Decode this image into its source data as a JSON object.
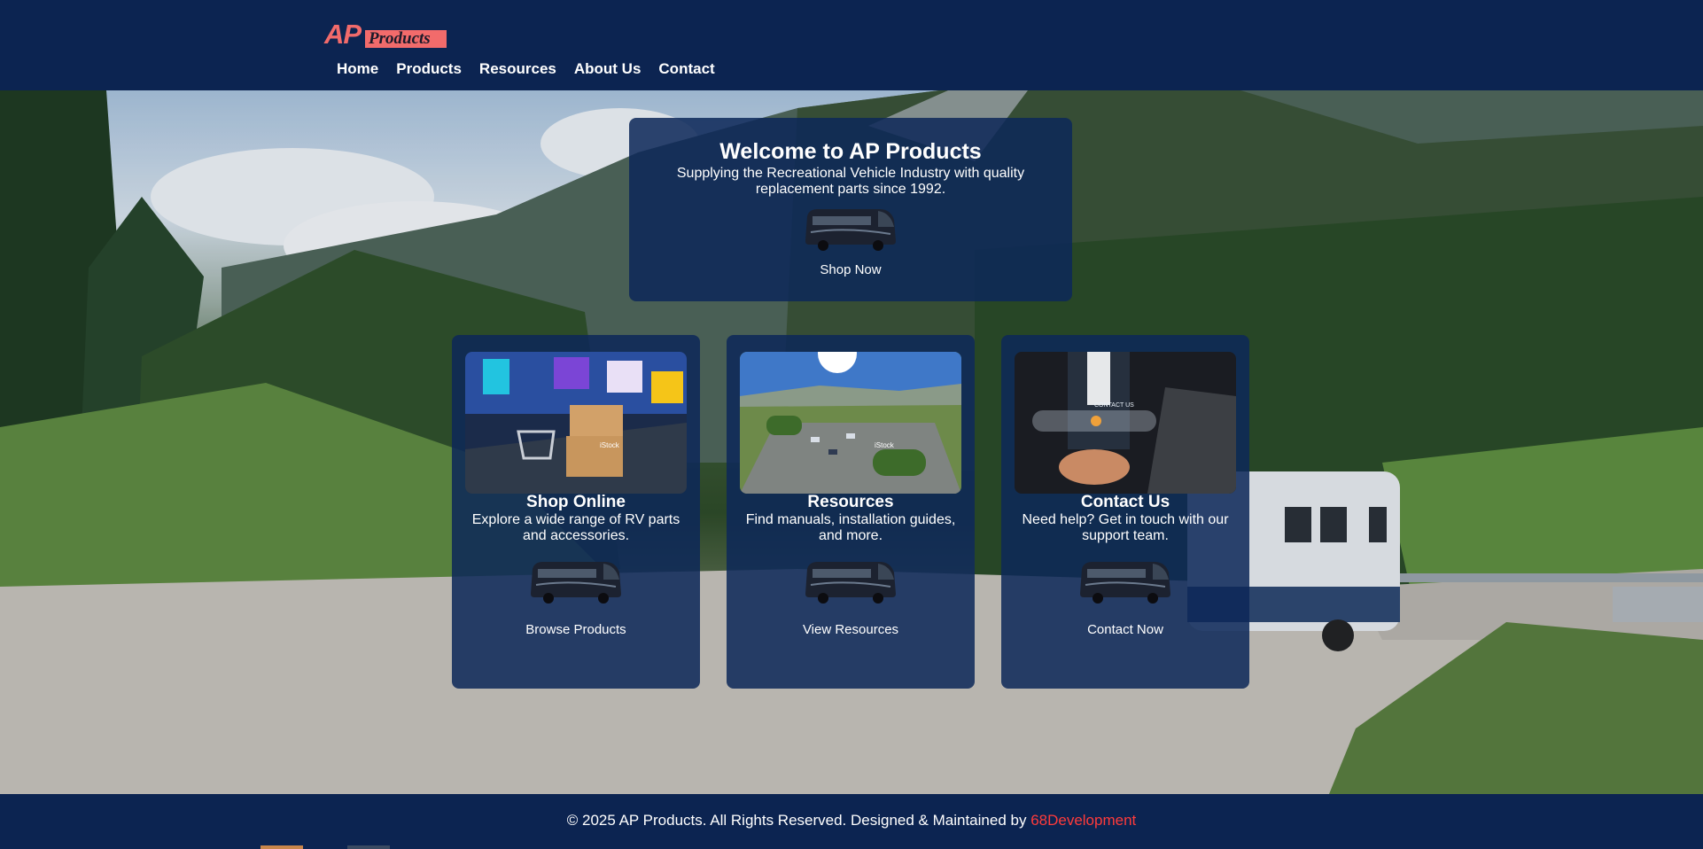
{
  "header": {
    "logo_ap": "AP",
    "logo_products": "Products",
    "nav": [
      "Home",
      "Products",
      "Resources",
      "About Us",
      "Contact"
    ]
  },
  "welcome": {
    "title": "Welcome to AP Products",
    "subtitle": "Supplying the Recreational Vehicle Industry with quality replacement parts since 1992.",
    "cta": "Shop Now"
  },
  "features": [
    {
      "title": "Shop Online",
      "text": "Explore a wide range of RV parts and accessories.",
      "cta": "Browse Products"
    },
    {
      "title": "Resources",
      "text": "Find manuals, installation guides, and more.",
      "cta": "View Resources"
    },
    {
      "title": "Contact Us",
      "text": "Need help? Get in touch with our support team.",
      "cta": "Contact Now"
    }
  ],
  "photo_text": {
    "contact_us": "CONTACT US",
    "istock": "iStock"
  },
  "footer": {
    "copyright": "© 2025 AP Products. All Rights Reserved. Designed & Maintained by ",
    "dev": "68Development"
  },
  "colors": {
    "header_bg": "#0c2451",
    "card_bg": "#0d2858",
    "logo": "#f26b6b",
    "dev_link": "#ff3b3b"
  }
}
